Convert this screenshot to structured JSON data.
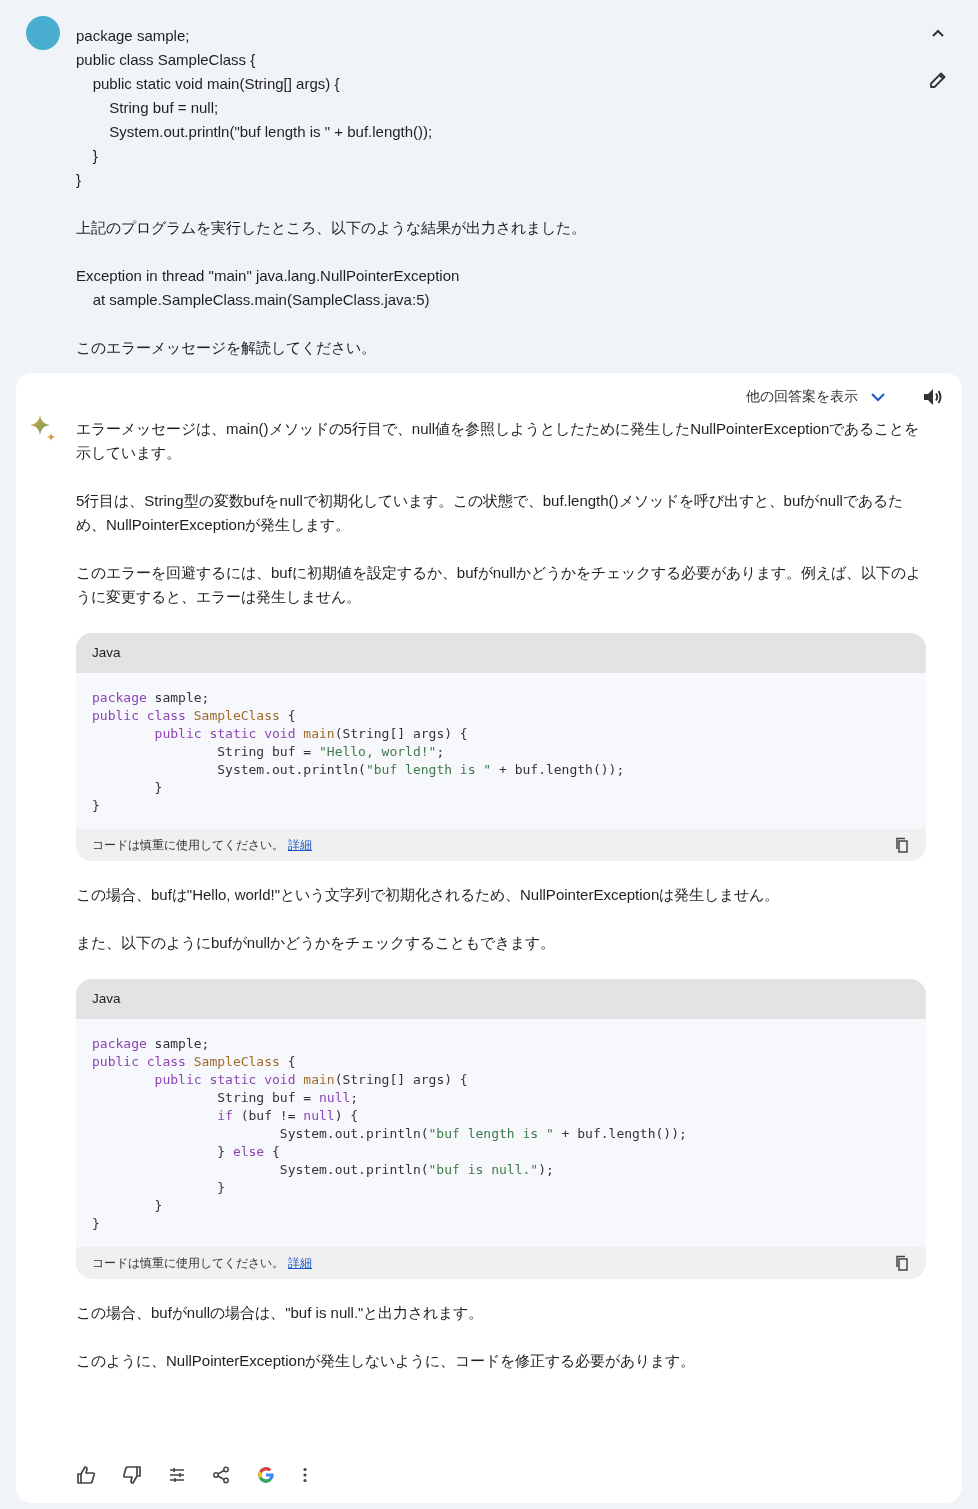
{
  "prompt": {
    "paragraphs": [
      [
        "package sample;",
        "public class SampleClass {",
        "\tpublic static void main(String[] args) {",
        "\t\tString buf = null;",
        "\t\tSystem.out.println(\"buf length is \" + buf.length());",
        "\t}",
        "}"
      ],
      [
        "上記のプログラムを実行したところ、以下のような結果が出力されました。"
      ],
      [
        "Exception in thread \"main\" java.lang.NullPointerException",
        "\tat sample.SampleClass.main(SampleClass.java:5)"
      ],
      [
        "このエラーメッセージを解読してください。"
      ]
    ]
  },
  "response": {
    "drafts_label": "他の回答案を表示",
    "blocks": [
      {
        "kind": "text",
        "text": "エラーメッセージは、main()メソッドの5行目で、null値を参照しようとしたために発生したNullPointerExceptionであることを示しています。"
      },
      {
        "kind": "text",
        "text": "5行目は、String型の変数bufをnullで初期化しています。この状態で、buf.length()メソッドを呼び出すと、bufがnullであるため、NullPointerExceptionが発生します。"
      },
      {
        "kind": "text",
        "text": "このエラーを回避するには、bufに初期値を設定するか、bufがnullかどうかをチェックする必要があります。例えば、以下のように変更すると、エラーは発生しません。"
      },
      {
        "kind": "code",
        "language": "Java",
        "note": "コードは慎重に使用してください。",
        "link": "詳細",
        "lines": [
          [
            {
              "text": "package",
              "kind": "keyword"
            },
            {
              "text": " sample;",
              "kind": "plain"
            }
          ],
          [
            {
              "text": "public class ",
              "kind": "keyword"
            },
            {
              "text": "SampleClass",
              "kind": "name"
            },
            {
              "text": " {",
              "kind": "plain"
            }
          ],
          [
            {
              "text": "        public static void ",
              "kind": "keyword"
            },
            {
              "text": "main",
              "kind": "name"
            },
            {
              "text": "(String[] args) {",
              "kind": "plain"
            }
          ],
          [
            {
              "text": "                String buf = ",
              "kind": "plain"
            },
            {
              "text": "\"Hello, world!\"",
              "kind": "string"
            },
            {
              "text": ";",
              "kind": "plain"
            }
          ],
          [
            {
              "text": "                System.out.println(",
              "kind": "plain"
            },
            {
              "text": "\"buf length is \"",
              "kind": "string"
            },
            {
              "text": " + buf.length());",
              "kind": "plain"
            }
          ],
          [
            {
              "text": "        }",
              "kind": "plain"
            }
          ],
          [
            {
              "text": "}",
              "kind": "plain"
            }
          ]
        ]
      },
      {
        "kind": "text",
        "text": "この場合、bufは\"Hello, world!\"という文字列で初期化されるため、NullPointerExceptionは発生しません。"
      },
      {
        "kind": "text",
        "text": "また、以下のようにbufがnullかどうかをチェックすることもできます。"
      },
      {
        "kind": "code",
        "language": "Java",
        "note": "コードは慎重に使用してください。",
        "link": "詳細",
        "lines": [
          [
            {
              "text": "package",
              "kind": "keyword"
            },
            {
              "text": " sample;",
              "kind": "plain"
            }
          ],
          [
            {
              "text": "public class ",
              "kind": "keyword"
            },
            {
              "text": "SampleClass",
              "kind": "name"
            },
            {
              "text": " {",
              "kind": "plain"
            }
          ],
          [
            {
              "text": "        public static void ",
              "kind": "keyword"
            },
            {
              "text": "main",
              "kind": "name"
            },
            {
              "text": "(String[] args) {",
              "kind": "plain"
            }
          ],
          [
            {
              "text": "                String buf = ",
              "kind": "plain"
            },
            {
              "text": "null",
              "kind": "keyword"
            },
            {
              "text": ";",
              "kind": "plain"
            }
          ],
          [
            {
              "text": "                if",
              "kind": "keyword"
            },
            {
              "text": " (buf != ",
              "kind": "plain"
            },
            {
              "text": "null",
              "kind": "keyword"
            },
            {
              "text": ") {",
              "kind": "plain"
            }
          ],
          [
            {
              "text": "                        System.out.println(",
              "kind": "plain"
            },
            {
              "text": "\"buf length is \"",
              "kind": "string"
            },
            {
              "text": " + buf.length());",
              "kind": "plain"
            }
          ],
          [
            {
              "text": "                } ",
              "kind": "plain"
            },
            {
              "text": "else",
              "kind": "keyword"
            },
            {
              "text": " {",
              "kind": "plain"
            }
          ],
          [
            {
              "text": "                        System.out.println(",
              "kind": "plain"
            },
            {
              "text": "\"buf is null.\"",
              "kind": "string"
            },
            {
              "text": ");",
              "kind": "plain"
            }
          ],
          [
            {
              "text": "                }",
              "kind": "plain"
            }
          ],
          [
            {
              "text": "        }",
              "kind": "plain"
            }
          ],
          [
            {
              "text": "}",
              "kind": "plain"
            }
          ]
        ]
      },
      {
        "kind": "text",
        "text": "この場合、bufがnullの場合は、\"buf is null.\"と出力されます。"
      },
      {
        "kind": "text",
        "text": "このように、NullPointerExceptionが発生しないように、コードを修正する必要があります。"
      }
    ]
  }
}
